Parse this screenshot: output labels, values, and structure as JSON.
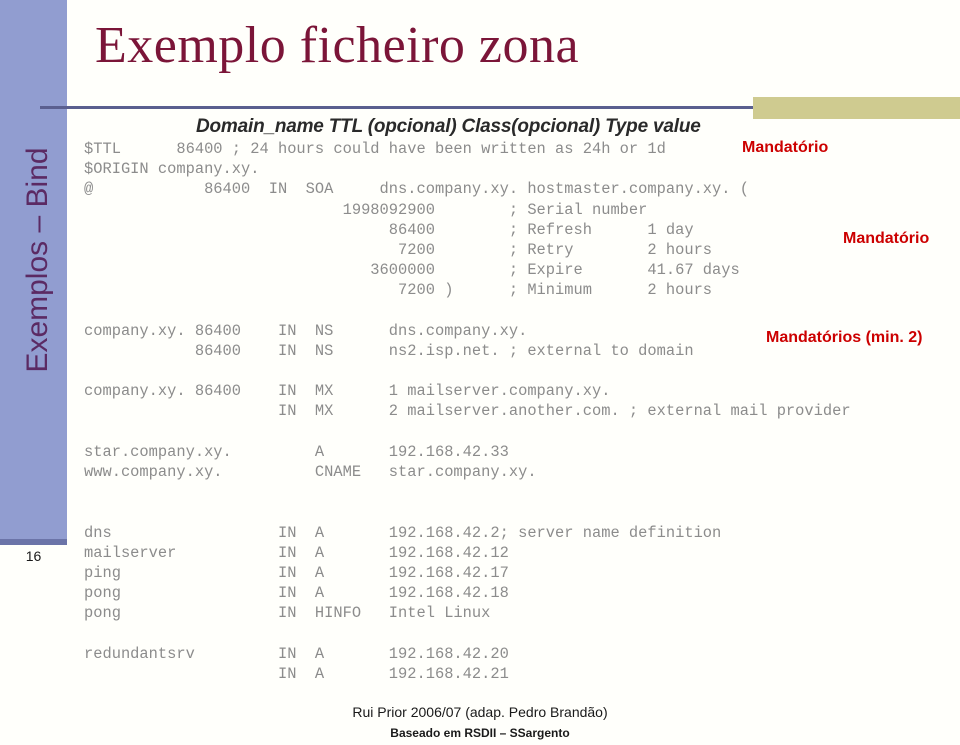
{
  "slide": {
    "title": "Exemplo ficheiro zona",
    "number": "16",
    "side_label": "Exemplos – Bind",
    "sub_header": "Domain_name TTL (opcional) Class(opcional) Type value"
  },
  "colors": {
    "title": "#7b1538",
    "side_band": "#919dd0",
    "side_label": "#5b2a63",
    "rule": "#5a5f8f",
    "khaki": "#cfcb90",
    "callout": "#cc0000",
    "mono_text": "#8c8c8c"
  },
  "zone_file": {
    "lines": [
      "$TTL      86400 ; 24 hours could have been written as 24h or 1d",
      "$ORIGIN company.xy.",
      "@            86400  IN  SOA     dns.company.xy. hostmaster.company.xy. (",
      "                            1998092900        ; Serial number",
      "                                 86400        ; Refresh      1 day",
      "                                  7200        ; Retry        2 hours",
      "                               3600000        ; Expire       41.67 days",
      "                                  7200 )      ; Minimum      2 hours",
      "",
      "company.xy. 86400    IN  NS      dns.company.xy.",
      "            86400    IN  NS      ns2.isp.net. ; external to domain",
      "",
      "company.xy. 86400    IN  MX      1 mailserver.company.xy.",
      "                     IN  MX      2 mailserver.another.com. ; external mail provider",
      "",
      "star.company.xy.         A       192.168.42.33",
      "www.company.xy.          CNAME   star.company.xy.",
      "",
      "",
      "dns                  IN  A       192.168.42.2; server name definition",
      "mailserver           IN  A       192.168.42.12",
      "ping                 IN  A       192.168.42.17",
      "pong                 IN  A       192.168.42.18",
      "pong                 IN  HINFO   Intel Linux",
      "",
      "redundantsrv         IN  A       192.168.42.20",
      "                     IN  A       192.168.42.21"
    ]
  },
  "callouts": {
    "ttl": "Mandatório",
    "soa": "Mandatório",
    "ns": "Mandatórios (min. 2)"
  },
  "footer": {
    "main": "Rui Prior 2006/07 (adap. Pedro Brandão)",
    "sub": "Baseado em RSDII – SSargento"
  }
}
